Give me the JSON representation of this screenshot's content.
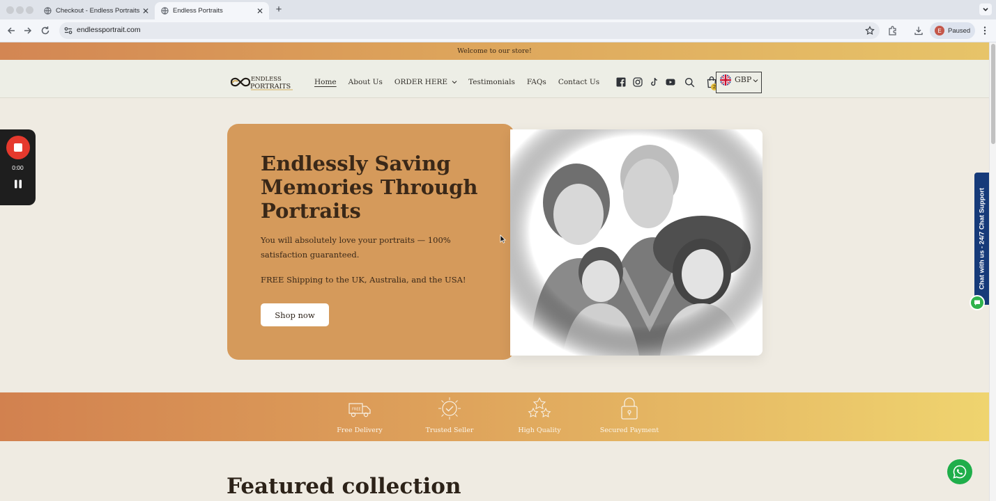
{
  "browser": {
    "tabs": [
      {
        "title": "Checkout - Endless Portraits",
        "active": false
      },
      {
        "title": "Endless Portraits",
        "active": true
      }
    ],
    "url": "endlessportrait.com",
    "profile": {
      "initial": "E",
      "status": "Paused"
    }
  },
  "announcement": "Welcome to our store!",
  "logo": {
    "line1": "ENDLESS",
    "line2": "PORTRAITS"
  },
  "nav": {
    "items": [
      "Home",
      "About Us",
      "ORDER HERE",
      "Testimonials",
      "FAQs",
      "Contact Us"
    ],
    "current": "Home"
  },
  "social_icons": [
    "facebook-icon",
    "instagram-icon",
    "tiktok-icon",
    "youtube-icon"
  ],
  "cart": {
    "count": "2"
  },
  "currency": {
    "code": "GBP"
  },
  "hero": {
    "title": "Endlessly Saving Memories Through Portraits",
    "subtitle": "You will absolutely love your portraits — 100% satisfaction guaranteed.",
    "shipping": "FREE Shipping to the UK, Australia, and the USA!",
    "cta": "Shop now"
  },
  "features": [
    {
      "label": "Free Delivery",
      "icon": "free-delivery-truck-icon",
      "badge": "FREE"
    },
    {
      "label": "Trusted Seller",
      "icon": "trusted-seller-badge-icon"
    },
    {
      "label": "High Quality",
      "icon": "stars-icon"
    },
    {
      "label": "Secured Payment",
      "icon": "padlock-icon"
    }
  ],
  "featured_title": "Featured collection",
  "recorder": {
    "time": "0:00"
  },
  "chat_support": "Chat with us - 24/7 Chat Support",
  "colors": {
    "hero_card": "#d59a5b",
    "chat_tab": "#163a79",
    "whatsapp": "#1fae4a",
    "record_red": "#e5392d"
  }
}
